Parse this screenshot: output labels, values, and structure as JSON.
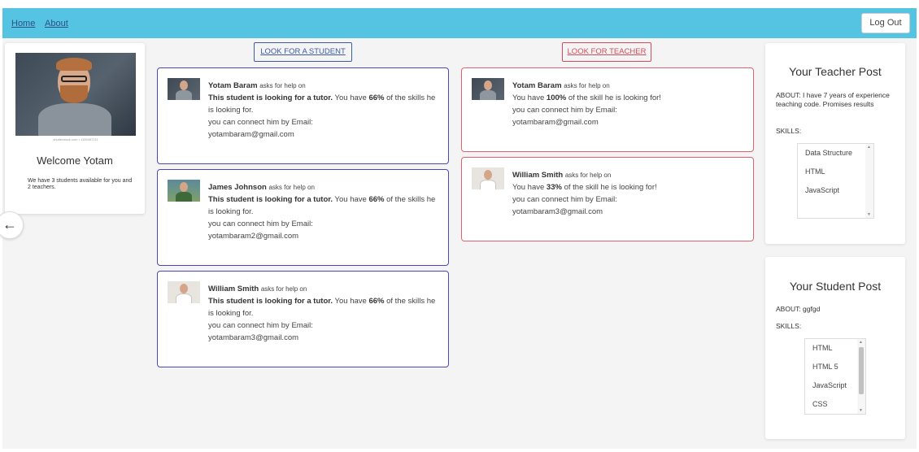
{
  "nav": {
    "home": "Home",
    "about": "About",
    "logout": "Log Out"
  },
  "profile": {
    "photo_caption": "shutterstock.com • 1155457211",
    "welcome": "Welcome Yotam",
    "availability": "We have 3 students available for you and 2 teachers."
  },
  "buttons": {
    "look_student": "LOOK FOR A STUDENT",
    "look_teacher": "LOOK FOR TEACHER"
  },
  "student_posts": [
    {
      "name": "Yotam Baram",
      "asks": "asks for help on",
      "lead": "This student is looking for a tutor.",
      "pre": "You have",
      "percent": "66%",
      "post": "of the skills he is looking for.",
      "connect": "you can connect him by Email:",
      "email": "yotambaram@gmail.com"
    },
    {
      "name": "James Johnson",
      "asks": "asks for help on",
      "lead": "This student is looking for a tutor.",
      "pre": "You have",
      "percent": "66%",
      "post": "of the skills he is looking for.",
      "connect": "you can connect him by Email:",
      "email": "yotambaram2@gmail.com"
    },
    {
      "name": "William Smith",
      "asks": "asks for help on",
      "lead": "This student is looking for a tutor.",
      "pre": "You have",
      "percent": "66%",
      "post": "of the skills he is looking for.",
      "connect": "you can connect him by Email:",
      "email": "yotambaram3@gmail.com"
    }
  ],
  "teacher_posts": [
    {
      "name": "Yotam Baram",
      "asks": "asks for help on",
      "pre": "You have",
      "percent": "100%",
      "post": "of the skill he is looking for!",
      "connect": "you can connect him by Email:",
      "email": "yotambaram@gmail.com"
    },
    {
      "name": "William Smith",
      "asks": "asks for help on",
      "pre": "You have",
      "percent": "33%",
      "post": "of the skill he is looking for!",
      "connect": "you can connect him by Email:",
      "email": "yotambaram3@gmail.com"
    }
  ],
  "teacher_post": {
    "title": "Your Teacher Post",
    "about": "ABOUT: I have 7 years of experience teaching code. Promises results",
    "skills_label": "SKILLS:",
    "skills": [
      "Data Structure",
      "HTML",
      "JavaScript"
    ]
  },
  "student_post": {
    "title": "Your Student Post",
    "about": "ABOUT: ggfgd",
    "skills_label": "SKILLS:",
    "skills": [
      "HTML",
      "HTML 5",
      "JavaScript",
      "CSS"
    ]
  },
  "colors": {
    "navbar": "#54c4e2",
    "student_accent": "#4b46b9",
    "teacher_accent": "#e06070"
  },
  "icons": {
    "back": "arrow-left-icon"
  }
}
